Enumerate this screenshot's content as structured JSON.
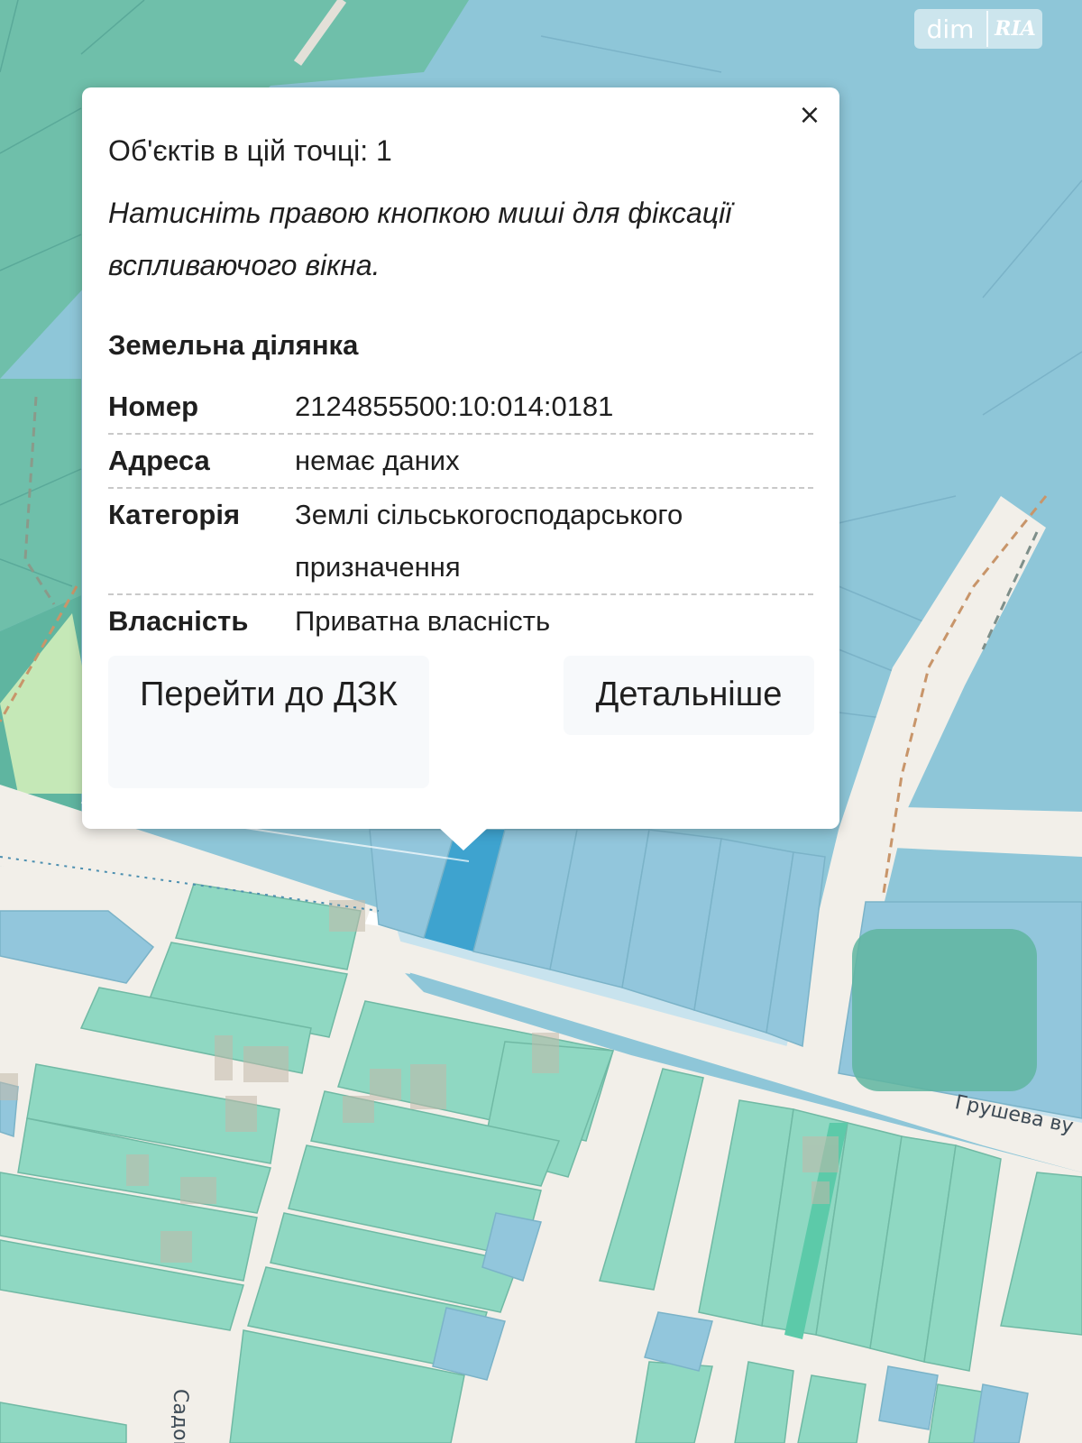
{
  "watermark": {
    "left": "dim",
    "right": "RIA"
  },
  "map": {
    "streets": [
      "Грушева ву",
      "Садов"
    ],
    "colors": {
      "water_background": "#8ec6d8",
      "parcel_green": "#8fd8c2",
      "parcel_blue": "#92c6dc",
      "road": "#f2efe9",
      "selected_parcel": "#3ea3cf",
      "forest": "#5fb5a0",
      "meadow": "#c5e8b7"
    }
  },
  "popup": {
    "close_symbol": "×",
    "objects_count": "Об'єктів в цій точці: 1",
    "hint": "Натисніть правою кнопкою миші для фіксації вспливаючого вікна.",
    "section_title": "Земельна ділянка",
    "rows": [
      {
        "key": "Номер",
        "value": "2124855500:10:014:0181"
      },
      {
        "key": "Адреса",
        "value": "немає даних"
      },
      {
        "key": "Категорія",
        "value": "Землі сільськогосподарського призначення"
      },
      {
        "key": "Власність",
        "value": "Приватна власність"
      }
    ],
    "buttons": {
      "go_to_dzk": "Перейти до ДЗК",
      "details": "Детальніше"
    }
  }
}
